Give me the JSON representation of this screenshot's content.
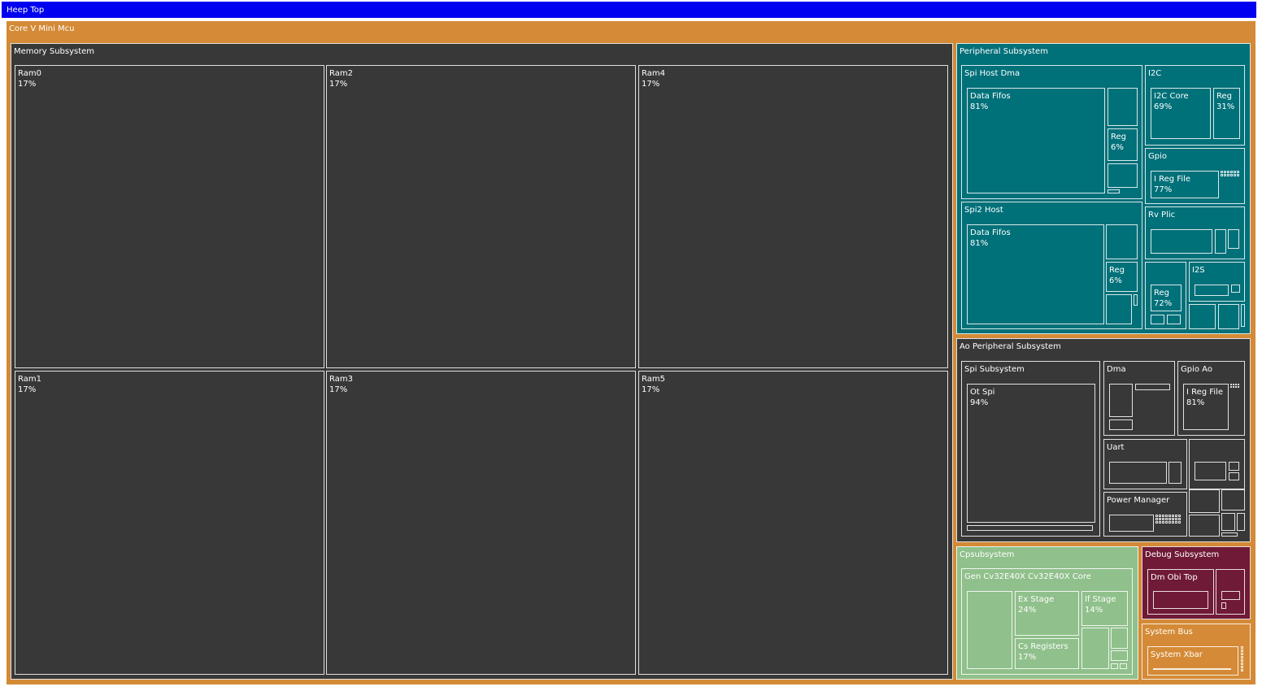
{
  "page": {
    "title": "Heep Top"
  },
  "colors": {
    "banner": "#0000f0",
    "root": "#d48a36",
    "memory": "#383838",
    "peripheral": "#007079",
    "ao": "#383838",
    "cpu": "#90c08b",
    "debug": "#6f1a37",
    "bus": "#d48a36",
    "border": "#ffffff"
  },
  "chart_data": {
    "type": "treemap",
    "title": "Heep Top",
    "root": {
      "name": "Core V Mini Mcu",
      "children": [
        {
          "name": "Memory Subsystem",
          "children": [
            {
              "name": "Ram0",
              "percent": 17
            },
            {
              "name": "Ram1",
              "percent": 17
            },
            {
              "name": "Ram2",
              "percent": 17
            },
            {
              "name": "Ram3",
              "percent": 17
            },
            {
              "name": "Ram4",
              "percent": 17
            },
            {
              "name": "Ram5",
              "percent": 17
            }
          ]
        },
        {
          "name": "Peripheral Subsystem",
          "children": [
            {
              "name": "Spi Host Dma",
              "children": [
                {
                  "name": "Data Fifos",
                  "percent": 81
                },
                {
                  "name": "Reg",
                  "percent": 6
                }
              ]
            },
            {
              "name": "Spi2 Host",
              "children": [
                {
                  "name": "Data Fifos",
                  "percent": 81
                },
                {
                  "name": "Reg",
                  "percent": 6
                }
              ]
            },
            {
              "name": "I2C",
              "children": [
                {
                  "name": "I2C Core",
                  "percent": 69
                },
                {
                  "name": "Reg",
                  "percent": 31
                }
              ]
            },
            {
              "name": "Gpio",
              "children": [
                {
                  "name": "I Reg File",
                  "percent": 77
                }
              ]
            },
            {
              "name": "Rv Plic"
            },
            {
              "name": "Reg",
              "percent": 72
            },
            {
              "name": "I2S"
            }
          ]
        },
        {
          "name": "Ao Peripheral Subsystem",
          "children": [
            {
              "name": "Spi Subsystem",
              "children": [
                {
                  "name": "Ot Spi",
                  "percent": 94
                }
              ]
            },
            {
              "name": "Dma"
            },
            {
              "name": "Gpio Ao",
              "children": [
                {
                  "name": "I Reg File",
                  "percent": 81
                }
              ]
            },
            {
              "name": "Uart"
            },
            {
              "name": "Power Manager"
            }
          ]
        },
        {
          "name": "Cpsubsystem",
          "children": [
            {
              "name": "Gen Cv32E40X Cv32E40X Core",
              "children": [
                {
                  "name": "Ex Stage",
                  "percent": 24
                },
                {
                  "name": "If Stage",
                  "percent": 14
                },
                {
                  "name": "Cs Registers",
                  "percent": 17
                }
              ]
            }
          ]
        },
        {
          "name": "Debug Subsystem",
          "children": [
            {
              "name": "Dm Obi Top"
            }
          ]
        },
        {
          "name": "System Bus",
          "children": [
            {
              "name": "System Xbar"
            }
          ]
        }
      ]
    }
  }
}
